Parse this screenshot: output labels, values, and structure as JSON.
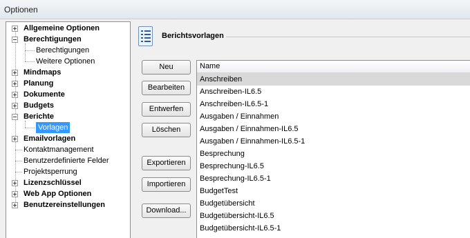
{
  "window": {
    "title": "Optionen"
  },
  "tree": [
    {
      "label": "Allgemeine Optionen",
      "level": 0,
      "bold": true,
      "expander": "plus"
    },
    {
      "label": "Berechtigungen",
      "level": 0,
      "bold": true,
      "expander": "minus"
    },
    {
      "label": "Berechtigungen",
      "level": 1,
      "bold": false,
      "expander": ""
    },
    {
      "label": "Weitere Optionen",
      "level": 1,
      "bold": false,
      "expander": ""
    },
    {
      "label": "Mindmaps",
      "level": 0,
      "bold": true,
      "expander": "plus"
    },
    {
      "label": "Planung",
      "level": 0,
      "bold": true,
      "expander": "plus"
    },
    {
      "label": "Dokumente",
      "level": 0,
      "bold": true,
      "expander": "plus"
    },
    {
      "label": "Budgets",
      "level": 0,
      "bold": true,
      "expander": "plus"
    },
    {
      "label": "Berichte",
      "level": 0,
      "bold": true,
      "expander": "minus"
    },
    {
      "label": "Vorlagen",
      "level": 1,
      "bold": false,
      "expander": "",
      "selected": true
    },
    {
      "label": "Emailvorlagen",
      "level": 0,
      "bold": true,
      "expander": "plus"
    },
    {
      "label": "Kontaktmanagement",
      "level": 0,
      "bold": false,
      "expander": ""
    },
    {
      "label": "Benutzerdefinierte Felder",
      "level": 0,
      "bold": false,
      "expander": ""
    },
    {
      "label": "Projektsperrung",
      "level": 0,
      "bold": false,
      "expander": ""
    },
    {
      "label": "Lizenzschlüssel",
      "level": 0,
      "bold": true,
      "expander": "plus"
    },
    {
      "label": "Web App Optionen",
      "level": 0,
      "bold": true,
      "expander": "plus"
    },
    {
      "label": "Benutzereinstellungen",
      "level": 0,
      "bold": true,
      "expander": "plus"
    }
  ],
  "section": {
    "title": "Berichtsvorlagen",
    "icon": "report-template-icon"
  },
  "buttons": {
    "new": "Neu",
    "edit": "Bearbeiten",
    "design": "Entwerfen",
    "delete": "Löschen",
    "export": "Exportieren",
    "import": "Importieren",
    "download": "Download..."
  },
  "list": {
    "column_header": "Name",
    "selected_index": 0,
    "items": [
      "Anschreiben",
      "Anschreiben-IL6.5",
      "Anschreiben-IL6.5-1",
      "Ausgaben / Einnahmen",
      "Ausgaben / Einnahmen-IL6.5",
      "Ausgaben / Einnahmen-IL6.5-1",
      "Besprechung",
      "Besprechung-IL6.5",
      "Besprechung-IL6.5-1",
      "BudgetTest",
      "Budgetübersicht",
      "Budgetübersicht-IL6.5",
      "Budgetübersicht-IL6.5-1"
    ]
  },
  "colors": {
    "selection": "#3399ff",
    "row_highlight": "#d9d9d9"
  }
}
